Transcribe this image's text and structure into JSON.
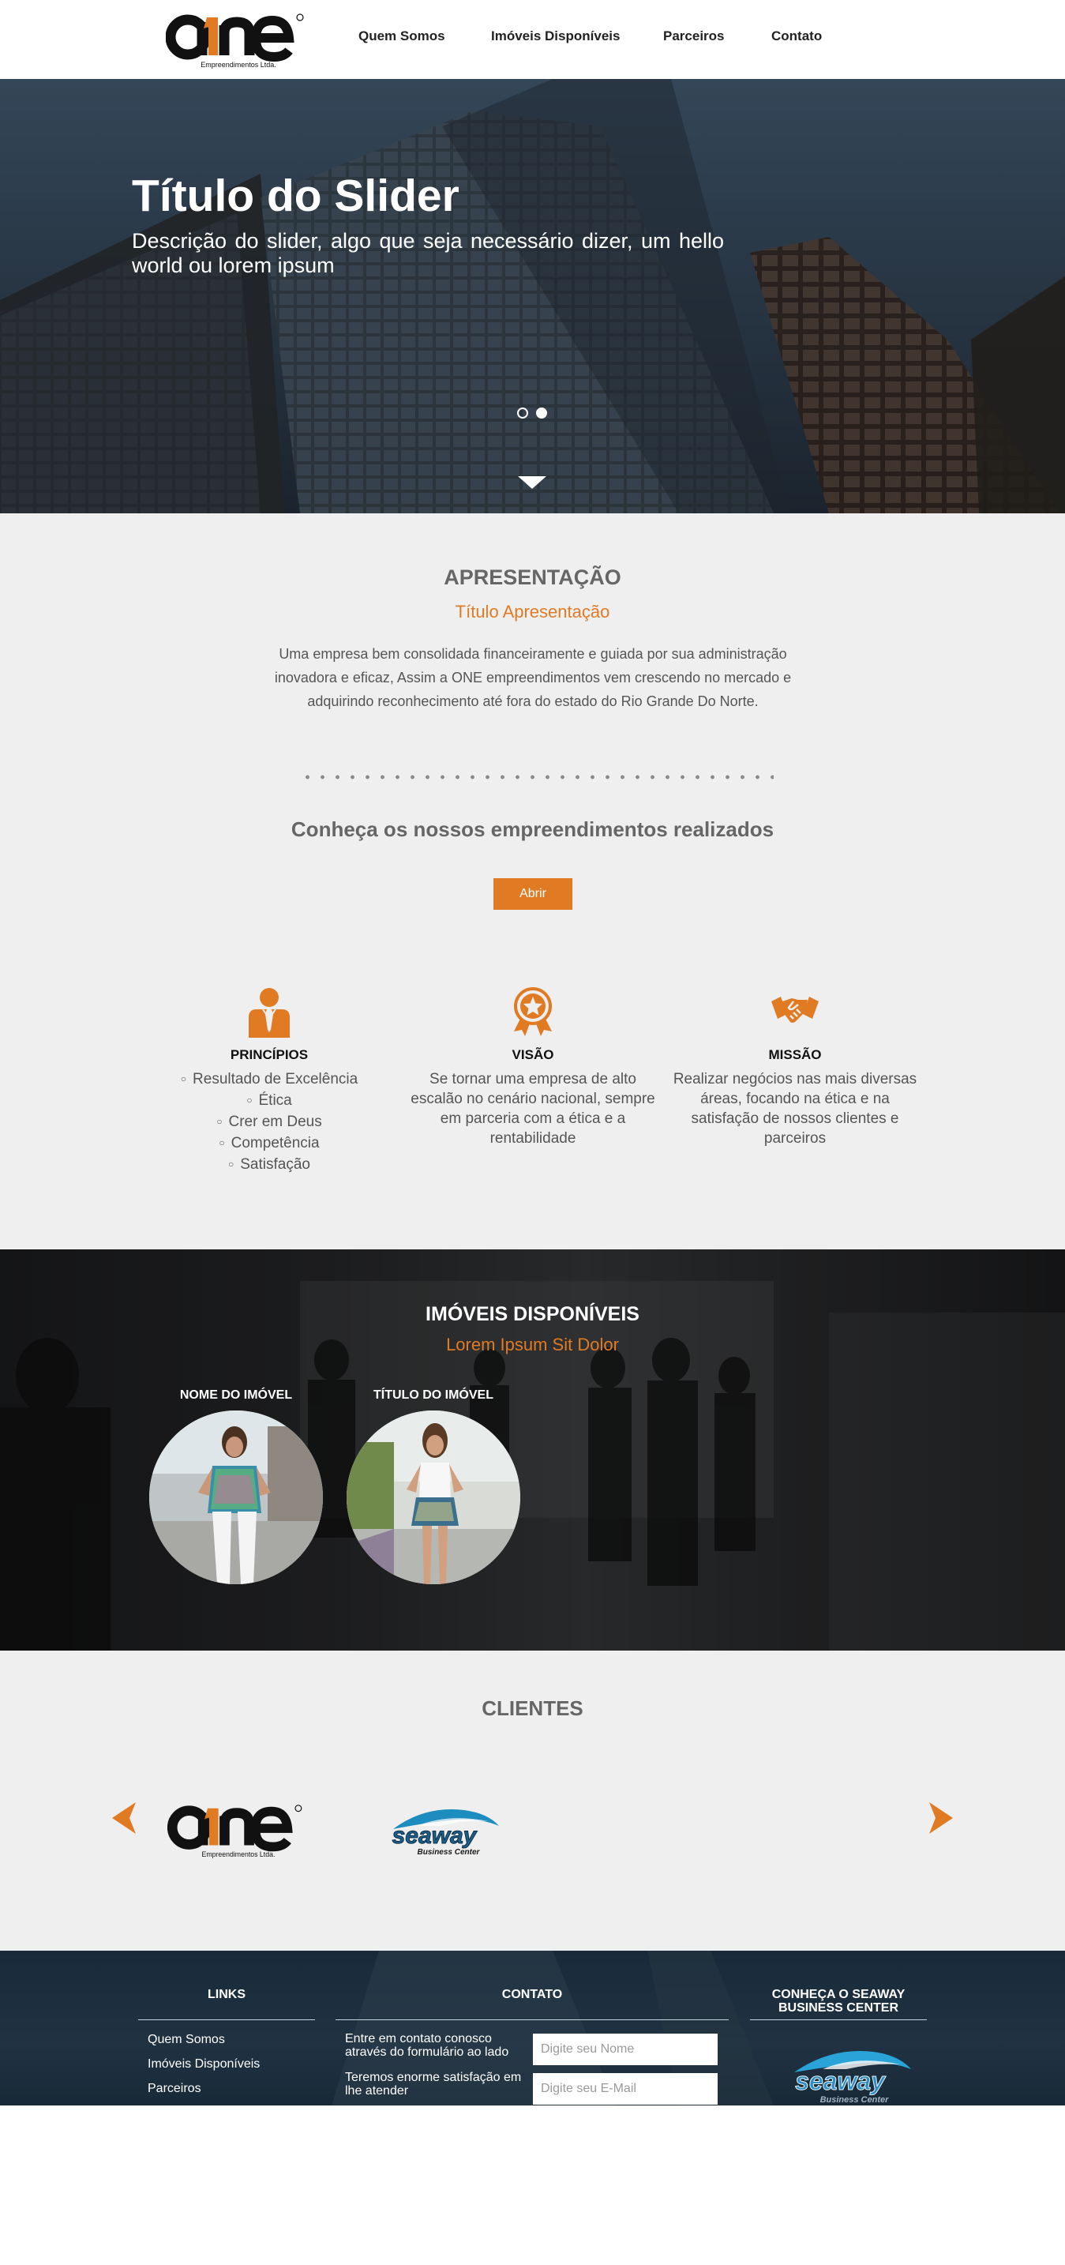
{
  "colors": {
    "accent": "#e07b24",
    "section_bg": "#efefef",
    "footer_bg": "#24384b"
  },
  "header": {
    "logo": {
      "word": "one",
      "subtitle": "Empreendimentos Ltda."
    },
    "nav": [
      "Quem Somos",
      "Imóveis Disponíveis",
      "Parceiros",
      "Contato"
    ]
  },
  "hero": {
    "title": "Título do Slider",
    "description": "Descrição do slider, algo que seja necessário dizer, um hello world ou lorem ipsum",
    "slides": 2,
    "active_slide": 2
  },
  "apresentacao": {
    "heading": "APRESENTAÇÃO",
    "subtitle": "Título Apresentação",
    "text": "Uma empresa bem consolidada financeiramente e guiada por sua administração inovadora e eficaz, Assim a ONE empreendimentos vem crescendo no mercado e adquirindo reconhecimento até fora do estado do Rio Grande Do Norte.",
    "cta_heading": "Conheça os nossos empreendimentos realizados",
    "cta_button": "Abrir"
  },
  "valores": {
    "principios": {
      "title": "PRINCÍPIOS",
      "icon": "person-tie-icon",
      "items": [
        "Resultado de Excelência",
        "Ética",
        "Crer em Deus",
        "Competência",
        "Satisfação"
      ]
    },
    "visao": {
      "title": "VISÃO",
      "icon": "award-star-icon",
      "text": "Se tornar uma empresa de alto escalão no cenário nacional, sempre em parceria com a ética e a rentabilidade"
    },
    "missao": {
      "title": "MISSÃO",
      "icon": "handshake-icon",
      "text": "Realizar negócios nas mais diversas áreas, focando na ética e na satisfação de nossos clientes e parceiros"
    }
  },
  "imoveis": {
    "heading": "IMÓVEIS DISPONÍVEIS",
    "subtitle": "Lorem Ipsum Sit Dolor",
    "items": [
      {
        "name": "NOME DO IMÓVEL"
      },
      {
        "name": "TÍTULO DO IMÓVEL"
      }
    ]
  },
  "clientes": {
    "heading": "CLIENTES",
    "logos": [
      {
        "word": "one",
        "subtitle": "Empreendimentos Ltda."
      },
      {
        "word": "seaway",
        "subtitle": "Business Center"
      }
    ]
  },
  "footer": {
    "links": {
      "heading": "LINKS",
      "items": [
        "Quem Somos",
        "Imóveis Disponíveis",
        "Parceiros"
      ]
    },
    "contato": {
      "heading": "CONTATO",
      "text1": "Entre em contato conosco através do formulário ao lado",
      "text2": "Teremos enorme satisfação em lhe atender",
      "name_placeholder": "Digite seu Nome",
      "email_placeholder": "Digite seu E-Mail"
    },
    "seaway": {
      "heading": "CONHEÇA O SEAWAY BUSINESS CENTER",
      "logo": {
        "word": "seaway",
        "subtitle": "Business Center"
      }
    }
  }
}
